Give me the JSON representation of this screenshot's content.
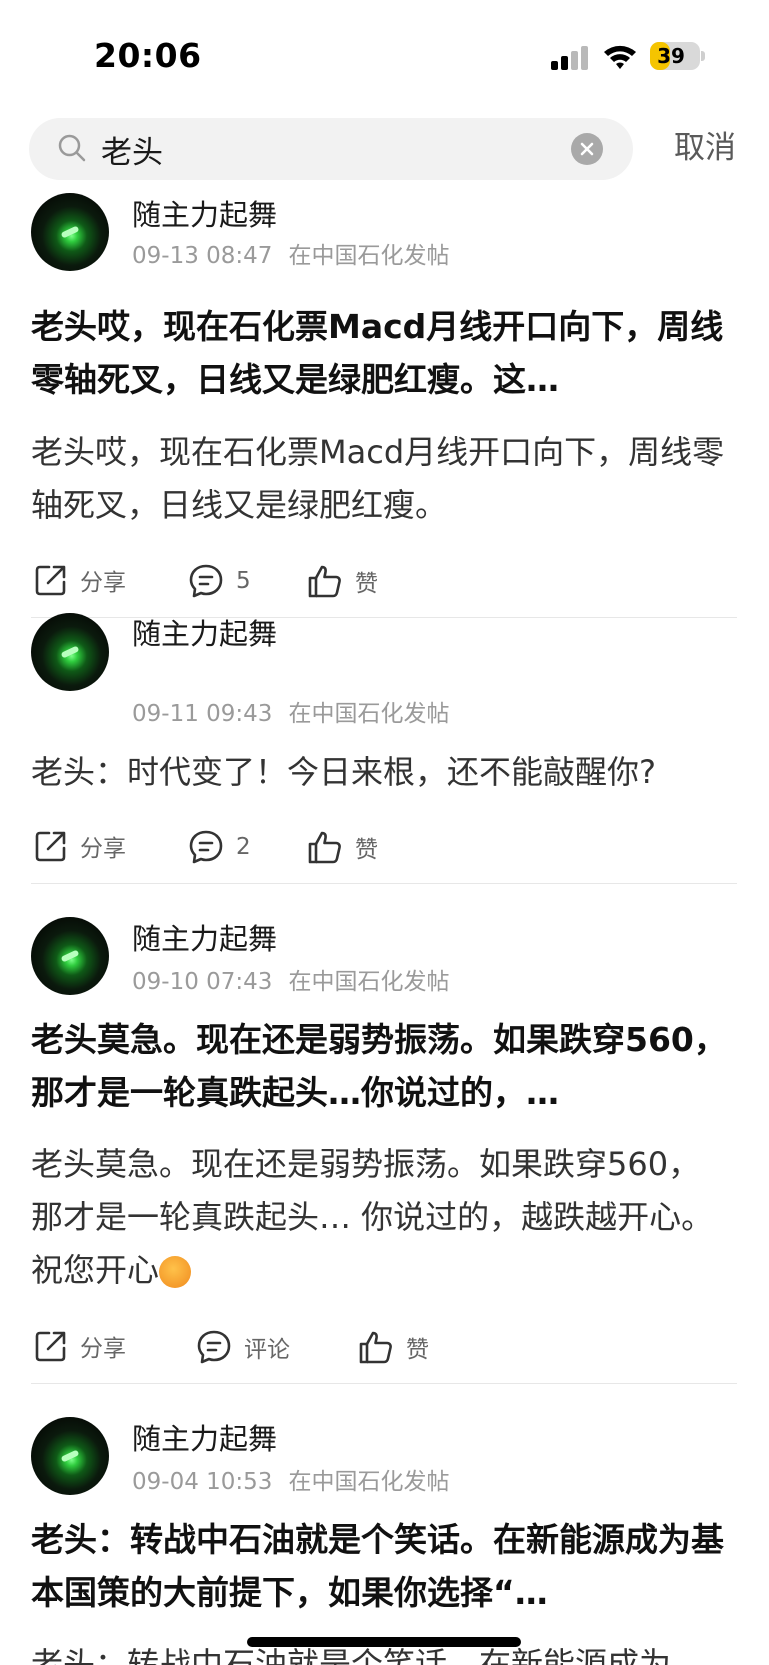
{
  "status_bar": {
    "time": "20:06",
    "battery": "39",
    "battery_level": 0.39
  },
  "search": {
    "query": "老头",
    "cancel_label": "取消"
  },
  "posts": [
    {
      "author": "随主力起舞",
      "time": "09-13 08:47",
      "source": "在中国石化发帖",
      "title": "老头哎，现在石化票Macd月线开口向下，周线零轴死叉，日线又是绿肥红瘦。这…",
      "body": "老头哎，现在石化票Macd月线开口向下，周线零轴死叉，日线又是绿肥红瘦。",
      "share_label": "分享",
      "comment_label": "5",
      "like_label": "赞"
    },
    {
      "author": "随主力起舞",
      "time": "09-11 09:43",
      "source": "在中国石化发帖",
      "body": "老头：时代变了！今日来根，还不能敲醒你?",
      "share_label": "分享",
      "comment_label": "2",
      "like_label": "赞"
    },
    {
      "author": "随主力起舞",
      "time": "09-10 07:43",
      "source": "在中国石化发帖",
      "title": "老头莫急。现在还是弱势振荡。如果跌穿560，那才是一轮真跌起头…你说过的，…",
      "body": "老头莫急。现在还是弱势振荡。如果跌穿560，那才是一轮真跌起头… 你说过的，越跌越开心。祝您开心",
      "share_label": "分享",
      "comment_label": "评论",
      "like_label": "赞"
    },
    {
      "author": "随主力起舞",
      "time": "09-04 10:53",
      "source": "在中国石化发帖",
      "title": "老头：转战中石油就是个笑话。在新能源成为基本国策的大前提下，如果你选择“…",
      "body": "老头：转战中石油就是个笑话。在新能源成为"
    }
  ]
}
